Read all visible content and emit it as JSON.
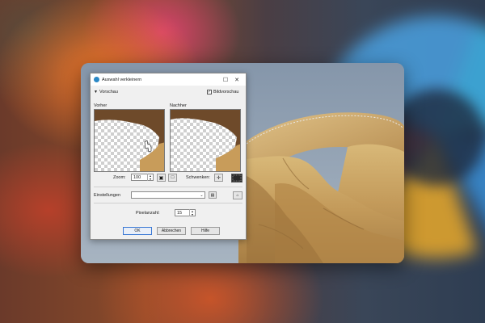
{
  "dialog": {
    "title": "Auswahl verkleinern",
    "maximize_glyph": "☐",
    "close_glyph": "✕",
    "preview_toggle": "Vorschau",
    "image_preview_label": "Bildvorschau",
    "image_preview_checked": true,
    "before_label": "Vorher",
    "after_label": "Nachher",
    "zoom_label": "Zoom:",
    "zoom_value": "100",
    "pan_label": "Schwenken:",
    "settings_label": "Einstellungen",
    "settings_value": "",
    "pixel_label": "Pixelanzahl:",
    "pixel_value": "15",
    "buttons": {
      "ok": "OK",
      "cancel": "Abbrechen",
      "help": "Hilfe"
    }
  },
  "colors": {
    "accent": "#3a78d4",
    "sand": "#c9a464",
    "sky": "#8d9fb2"
  }
}
